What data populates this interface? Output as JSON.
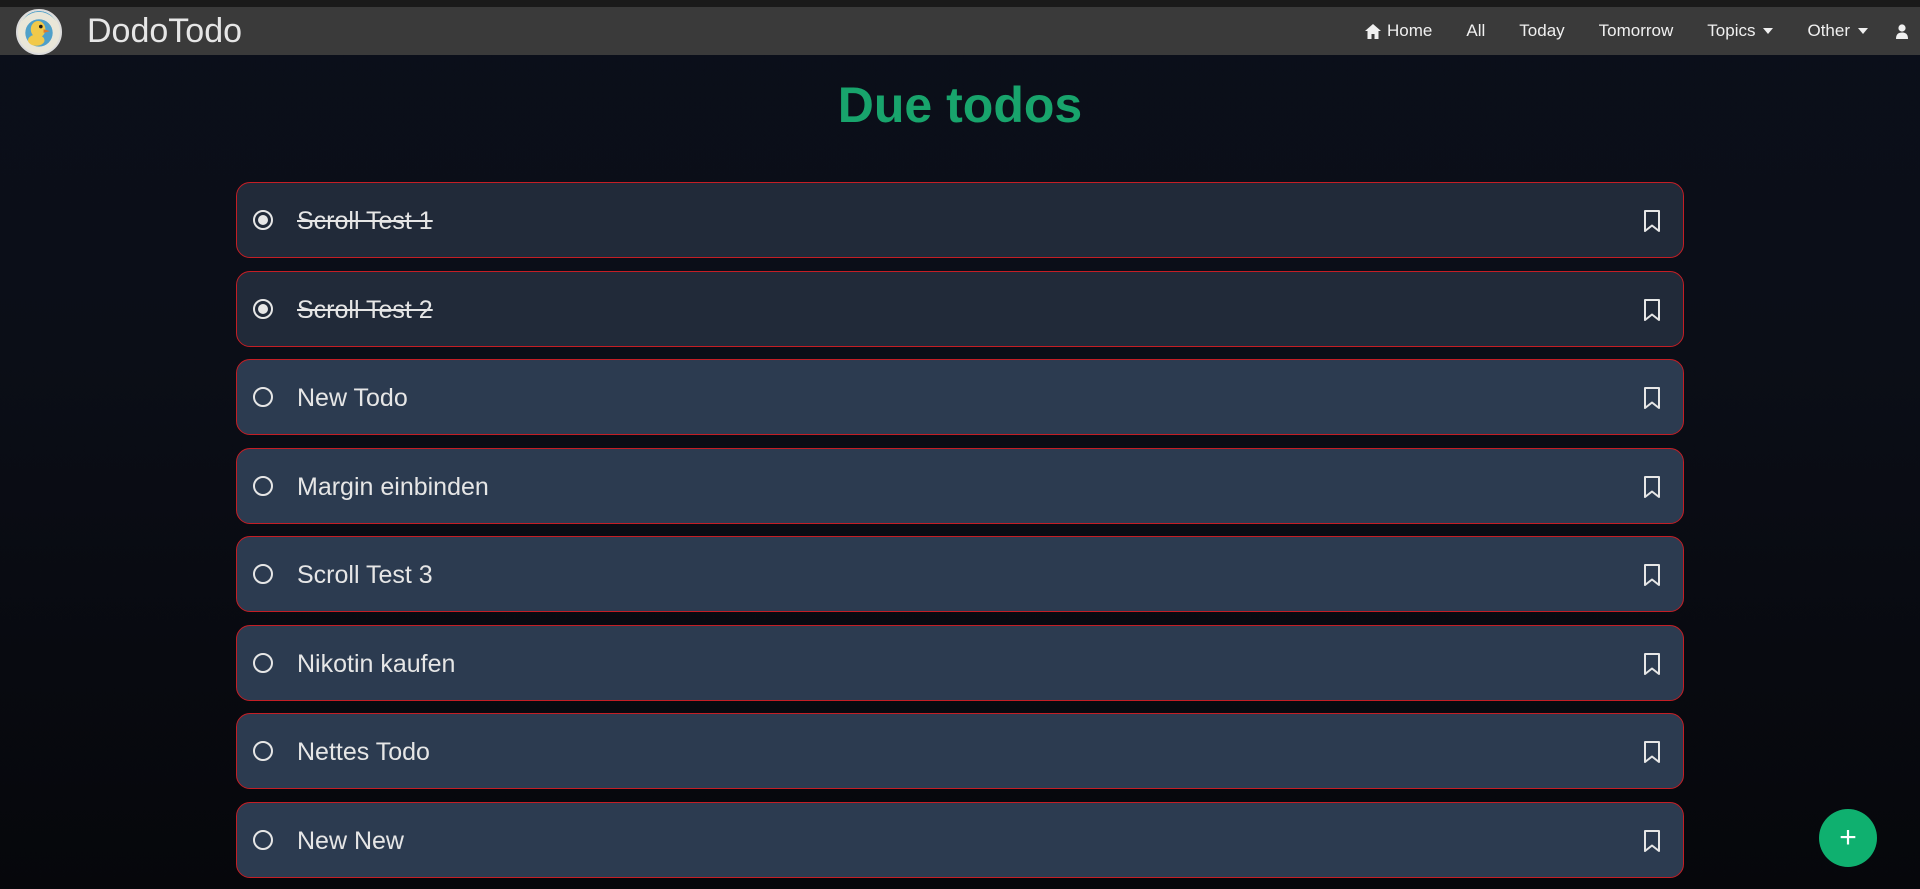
{
  "app": {
    "brand": "DodoTodo"
  },
  "nav": {
    "home": "Home",
    "all": "All",
    "today": "Today",
    "tomorrow": "Tomorrow",
    "topics": "Topics",
    "other": "Other"
  },
  "page": {
    "title": "Due todos"
  },
  "todos": [
    {
      "label": "Scroll Test 1",
      "done": true
    },
    {
      "label": "Scroll Test 2",
      "done": true
    },
    {
      "label": "New Todo",
      "done": false
    },
    {
      "label": "Margin einbinden",
      "done": false
    },
    {
      "label": "Scroll Test 3",
      "done": false
    },
    {
      "label": "Nikotin kaufen",
      "done": false
    },
    {
      "label": "Nettes Todo",
      "done": false
    },
    {
      "label": "New New",
      "done": false
    }
  ],
  "fab": {
    "label": "+"
  },
  "colors": {
    "accent": "#18a46c",
    "fab": "#0fb06f",
    "todo_border": "#c41e25",
    "navbar": "#3a3a3a"
  },
  "icons": {
    "home": "home-icon",
    "user": "user-icon",
    "bookmark": "bookmark-icon",
    "logo": "dodo-logo"
  }
}
